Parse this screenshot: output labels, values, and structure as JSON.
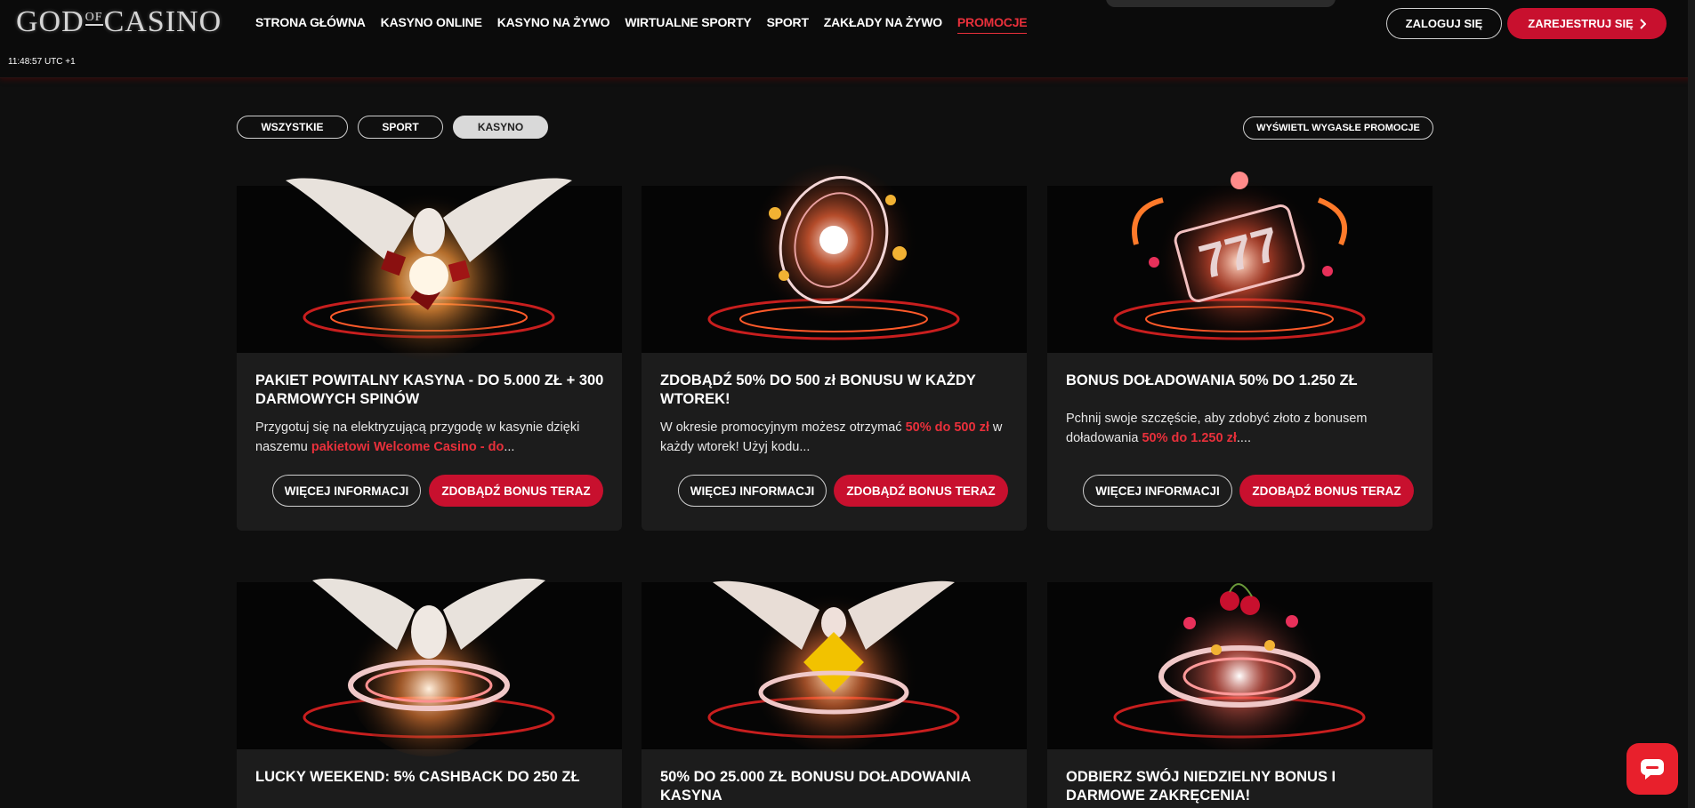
{
  "header": {
    "logo_left": "GOD",
    "logo_of": "OF",
    "logo_right": "CASINO",
    "clock": "11:48:57 UTC +1",
    "nav": [
      {
        "label": "STRONA GŁÓWNA"
      },
      {
        "label": "KASYNO ONLINE"
      },
      {
        "label": "KASYNO NA ŻYWO"
      },
      {
        "label": "WIRTUALNE SPORTY"
      },
      {
        "label": "SPORT"
      },
      {
        "label": "ZAKŁADY NA ŻYWO"
      },
      {
        "label": "PROMOCJE"
      }
    ],
    "login_label": "ZALOGUJ SIĘ",
    "register_label": "ZAREJESTRUJ SIĘ",
    "accent": "#c8102e"
  },
  "filters": {
    "all": "WSZYSTKIE",
    "sport": "SPORT",
    "casino": "KASYNO",
    "selected": "KASYNO",
    "expired_label": "WYŚWIETL WYGASŁE PROMOCJE"
  },
  "cards": [
    {
      "title": "PAKIET POWITALNY KASYNA - DO 5.000 ZŁ + 300 DARMOWYCH SPINÓW",
      "desc_plain": "Przygotuj się na elektryzującą przygodę w kasynie dzięki naszemu ",
      "desc_highlight": "pakietowi Welcome Casino - do",
      "desc_tail": "...",
      "illustration": "winged-angel-dice-icon",
      "info_label": "WIĘCEJ INFORMACJI",
      "bonus_label": "ZDOBĄDŹ BONUS TERAZ"
    },
    {
      "title": "ZDOBĄDŹ 50% DO 500 zł BONUSU W KAŻDY WTOREK!",
      "desc_plain": "W okresie promocyjnym możesz otrzymać ",
      "desc_highlight": "50% do 500 zł",
      "desc_tail": " w każdy wtorek! Użyj kodu...",
      "illustration": "roulette-wheel-icon",
      "info_label": "WIĘCEJ INFORMACJI",
      "bonus_label": "ZDOBĄDŹ BONUS TERAZ"
    },
    {
      "title": "BONUS DOŁADOWANIA 50% DO 1.250 ZŁ",
      "desc_plain": "Pchnij swoje szczęście, aby zdobyć złoto z bonusem doładowania ",
      "desc_highlight": "50% do 1.250 zł",
      "desc_tail": "....",
      "illustration": "slot-777-icon",
      "info_label": "WIĘCEJ INFORMACJI",
      "bonus_label": "ZDOBĄDŹ BONUS TERAZ"
    },
    {
      "title": "LUCKY WEEKEND: 5% CASHBACK DO 250 ZŁ",
      "illustration": "winged-angel-ring-icon"
    },
    {
      "title": "50% DO 25.000 ZŁ BONUSU DOŁADOWANIA KASYNA",
      "illustration": "winged-angel-cube-icon"
    },
    {
      "title": "ODBIERZ SWÓJ NIEDZIELNY BONUS I DARMOWE ZAKRĘCENIA!",
      "illustration": "cherries-ring-icon"
    }
  ],
  "chat_icon": "chat-bubble-icon"
}
